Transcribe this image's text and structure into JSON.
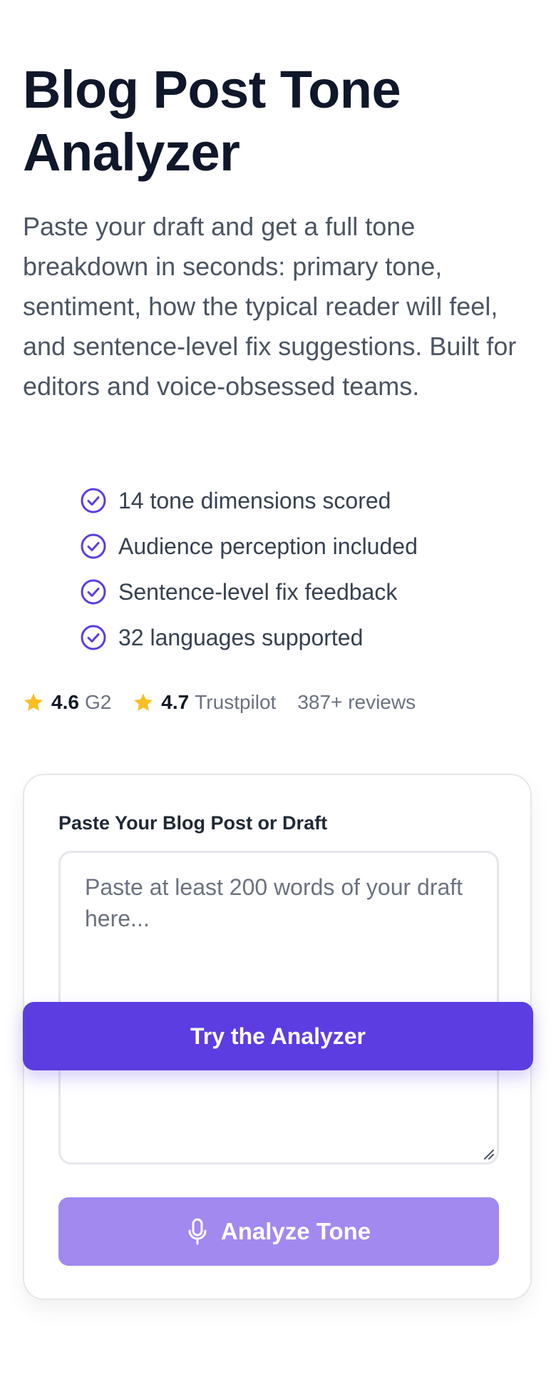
{
  "hero": {
    "title": "Blog Post Tone Analyzer",
    "subtitle": "Paste your draft and get a full tone breakdown in seconds: primary tone, sentiment, how the typical reader will feel, and sentence-level fix suggestions. Built for editors and voice-obsessed teams."
  },
  "features": [
    {
      "label": "14 tone dimensions scored",
      "icon": "check-circle-icon"
    },
    {
      "label": "Audience perception included",
      "icon": "check-circle-icon"
    },
    {
      "label": "Sentence-level fix feedback",
      "icon": "check-circle-icon"
    },
    {
      "label": "32 languages supported",
      "icon": "check-circle-icon"
    }
  ],
  "ratings": {
    "g2": {
      "score": "4.6",
      "source": "G2"
    },
    "trustpilot": {
      "score": "4.7",
      "source": "Trustpilot"
    },
    "reviews": "387+ reviews"
  },
  "form": {
    "label": "Paste Your Blog Post or Draft",
    "placeholder": "Paste at least 200 words of your draft here...",
    "value": "",
    "analyze_label": "Analyze Tone",
    "analyze_icon": "microphone-icon"
  },
  "cta": {
    "label": "Try the Analyzer"
  },
  "colors": {
    "accent": "#5b3de2",
    "accent_disabled": "#a189f0",
    "check": "#5b3de2",
    "star": "#fbbf24",
    "heading": "#0f172a",
    "body": "#4b5563"
  }
}
